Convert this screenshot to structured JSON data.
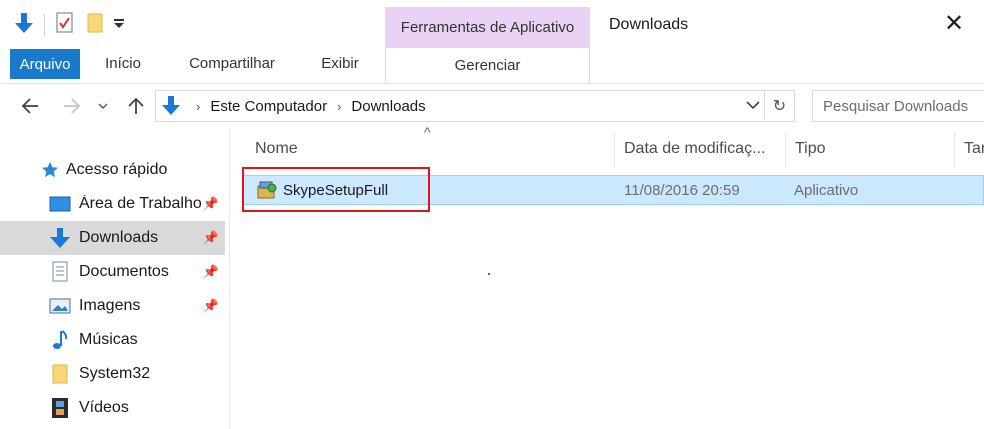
{
  "window": {
    "title": "Downloads"
  },
  "quick_access_toolbar": {
    "icons": [
      "down-arrow-icon",
      "properties-checklist-icon",
      "new-folder-icon",
      "customize-dropdown-icon"
    ]
  },
  "ribbon": {
    "context_group_label": "Ferramentas de Aplicativo",
    "tabs": [
      {
        "label": "Arquivo",
        "active": true
      },
      {
        "label": "Início"
      },
      {
        "label": "Compartilhar"
      },
      {
        "label": "Exibir"
      },
      {
        "label": "Gerenciar"
      }
    ]
  },
  "address_bar": {
    "breadcrumbs": [
      "Este Computador",
      "Downloads"
    ]
  },
  "search": {
    "placeholder": "Pesquisar Downloads"
  },
  "nav_pane": {
    "items": [
      {
        "label": "Acesso rápido",
        "icon": "star-icon"
      },
      {
        "label": "Área de Trabalho",
        "icon": "desktop-icon",
        "pinned": true
      },
      {
        "label": "Downloads",
        "icon": "download-arrow-icon",
        "pinned": true,
        "selected": true
      },
      {
        "label": "Documentos",
        "icon": "document-icon",
        "pinned": true
      },
      {
        "label": "Imagens",
        "icon": "image-icon",
        "pinned": true
      },
      {
        "label": "Músicas",
        "icon": "music-note-icon"
      },
      {
        "label": "System32",
        "icon": "folder-icon"
      },
      {
        "label": "Vídeos",
        "icon": "video-film-icon"
      }
    ]
  },
  "columns": [
    "Nome",
    "Data de modificaç...",
    "Tipo",
    "Tar"
  ],
  "files": [
    {
      "name": "SkypeSetupFull",
      "modified": "11/08/2016 20:59",
      "type": "Aplicativo",
      "icon": "installer-icon"
    }
  ],
  "colors": {
    "accent": "#1979ca",
    "context_tab": "#e9d2f4",
    "selection": "#cce8ff",
    "annotation": "#e0141a"
  }
}
